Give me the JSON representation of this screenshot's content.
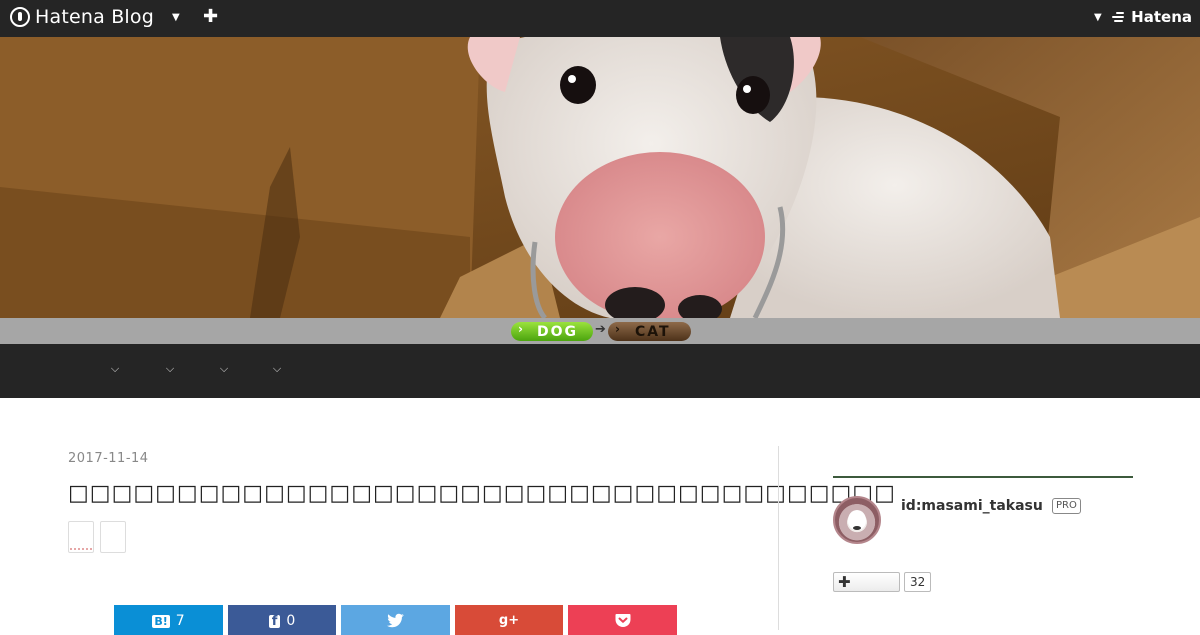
{
  "topbar": {
    "brand": "Hatena Blog",
    "right_brand": "Hatena",
    "icons": {
      "brand_logo": "hatena-blog-logo-icon",
      "menu_caret": "chevron-down-icon",
      "add": "plus-icon",
      "hatena_mark": "hatena-logo-icon"
    }
  },
  "header": {
    "image": "bull-terrier-in-box-photo",
    "links": {
      "dog": "DOG",
      "cat": "CAT"
    }
  },
  "nav": {
    "items": [
      {
        "label": "",
        "icon": "chevron-down-icon"
      },
      {
        "label": "",
        "icon": "chevron-down-icon"
      },
      {
        "label": "",
        "icon": "chevron-down-icon"
      },
      {
        "label": "",
        "icon": "chevron-down-icon"
      }
    ]
  },
  "post": {
    "date": "2017-11-14",
    "title": "□□□□□□□□□□□□□□□□□□□□□□□□□□□□□□□□□□□□□□"
  },
  "share": {
    "hatebu": {
      "icon": "hatena-bookmark-icon",
      "label": "B!",
      "count": "7"
    },
    "facebook": {
      "icon": "facebook-icon",
      "label": "f",
      "count": "0"
    },
    "twitter": {
      "icon": "twitter-icon",
      "label": ""
    },
    "googleplus": {
      "icon": "google-plus-icon",
      "label": "g+"
    },
    "pocket": {
      "icon": "pocket-icon",
      "label": ""
    }
  },
  "sidebar": {
    "user_id": "id:masami_takasu",
    "badge": "PRO",
    "follow_icon": "plus-icon",
    "follow_label": "✚",
    "reader_count": "32"
  },
  "colors": {
    "topbar_bg": "#252525",
    "strip_bg": "#a6a6a6",
    "dog_pill": "#6cc31f",
    "cat_pill": "#6b4a2d",
    "hatebu": "#0a8fd6",
    "facebook": "#3b5a97",
    "twitter": "#5ca7e2",
    "googleplus": "#d84b38",
    "pocket": "#ed4055"
  }
}
